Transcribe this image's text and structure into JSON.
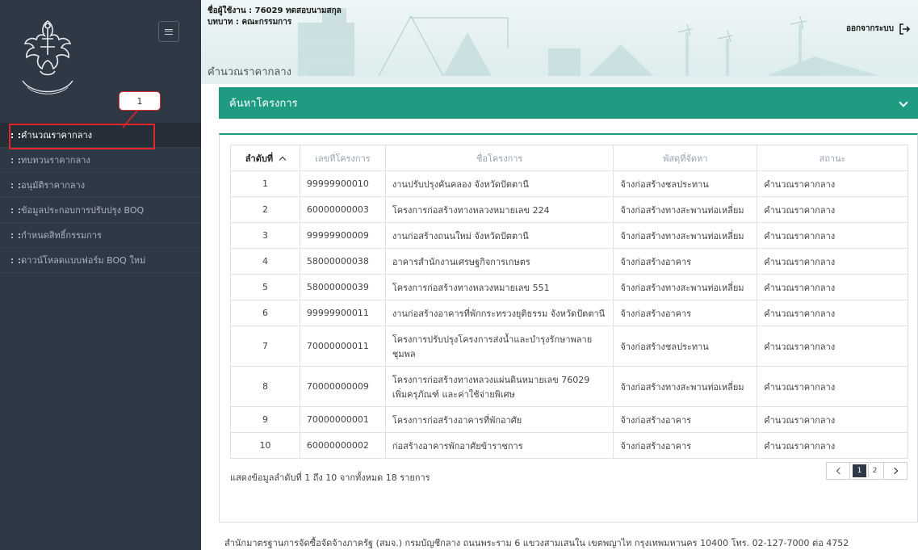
{
  "header": {
    "user": "ชื่อผู้ใช้งาน : 76029 ทดสอบนามสกุล",
    "role": "บทบาท : คณะกรรมการ",
    "logout_label": "ออกจากระบบ",
    "page_title": "คำนวณราคากลาง"
  },
  "callout": {
    "label": "1"
  },
  "sidebar": {
    "items": [
      {
        "label": "คำนวณราคากลาง"
      },
      {
        "label": "ทบทวนราคากลาง"
      },
      {
        "label": "อนุมัติราคากลาง"
      },
      {
        "label": "ข้อมูลประกอบการปรับปรุง BOQ"
      },
      {
        "label": "กำหนดสิทธิ์กรรมการ"
      },
      {
        "label": "ดาวน์โหลดแบบฟอร์ม BOQ ใหม่"
      }
    ]
  },
  "search": {
    "label": "ค้นหาโครงการ"
  },
  "table": {
    "headers": [
      "ลำดับที่",
      "เลขที่โครงการ",
      "ชื่อโครงการ",
      "พัสดุที่จัดหา",
      "สถานะ"
    ],
    "rows": [
      [
        "1",
        "99999900010",
        "งานปรับปรุงคันคลอง จังหวัดปัตตานี",
        "จ้างก่อสร้างชลประทาน",
        "คำนวณราคากลาง"
      ],
      [
        "2",
        "60000000003",
        "โครงการก่อสร้างทางหลวงหมายเลข 224",
        "จ้างก่อสร้างทางสะพานท่อเหลี่ยม",
        "คำนวณราคากลาง"
      ],
      [
        "3",
        "99999900009",
        "งานก่อสร้างถนนใหม่ จังหวัดปัตตานี",
        "จ้างก่อสร้างทางสะพานท่อเหลี่ยม",
        "คำนวณราคากลาง"
      ],
      [
        "4",
        "58000000038",
        "อาคารสำนักงานเศรษฐกิจการเกษตร",
        "จ้างก่อสร้างอาคาร",
        "คำนวณราคากลาง"
      ],
      [
        "5",
        "58000000039",
        "โครงการก่อสร้างทางหลวงหมายเลข 551",
        "จ้างก่อสร้างทางสะพานท่อเหลี่ยม",
        "คำนวณราคากลาง"
      ],
      [
        "6",
        "99999900011",
        "งานก่อสร้างอาคารที่พักกระทรวงยุติธรรม จังหวัดปัตตานี",
        "จ้างก่อสร้างอาคาร",
        "คำนวณราคากลาง"
      ],
      [
        "7",
        "70000000011",
        "โครงการปรับปรุงโครงการส่งน้ำและบำรุงรักษาพลายชุมพล",
        "จ้างก่อสร้างชลประทาน",
        "คำนวณราคากลาง"
      ],
      [
        "8",
        "70000000009",
        "โครงการก่อสร้างทางหลวงแผ่นดินหมายเลข 76029 เพิ่มครุภัณฑ์ และค่าใช้จ่ายพิเศษ",
        "จ้างก่อสร้างทางสะพานท่อเหลี่ยม",
        "คำนวณราคากลาง"
      ],
      [
        "9",
        "70000000001",
        "โครงการก่อสร้างอาคารที่พักอาศัย",
        "จ้างก่อสร้างอาคาร",
        "คำนวณราคากลาง"
      ],
      [
        "10",
        "60000000002",
        "ก่อสร้างอาคารพักอาศัยข้าราชการ",
        "จ้างก่อสร้างอาคาร",
        "คำนวณราคากลาง"
      ]
    ],
    "summary": "แสดงข้อมูลลำดับที่ 1 ถึง 10 จากทั้งหมด 18 รายการ",
    "pages": [
      "1",
      "2"
    ],
    "current_page": "1"
  },
  "footer": {
    "text": "สำนักมาตรฐานการจัดซื้อจัดจ้างภาครัฐ (สมจ.) กรมบัญชีกลาง ถนนพระราม 6 แขวงสามเสนใน เขตพญาไท กรุงเทพมหานคร 10400 โทร. 02-127-7000 ต่อ 4752"
  },
  "colors": {
    "sidebar": "#2f3945",
    "accent": "#1e9b80",
    "highlight": "#e0252b"
  }
}
